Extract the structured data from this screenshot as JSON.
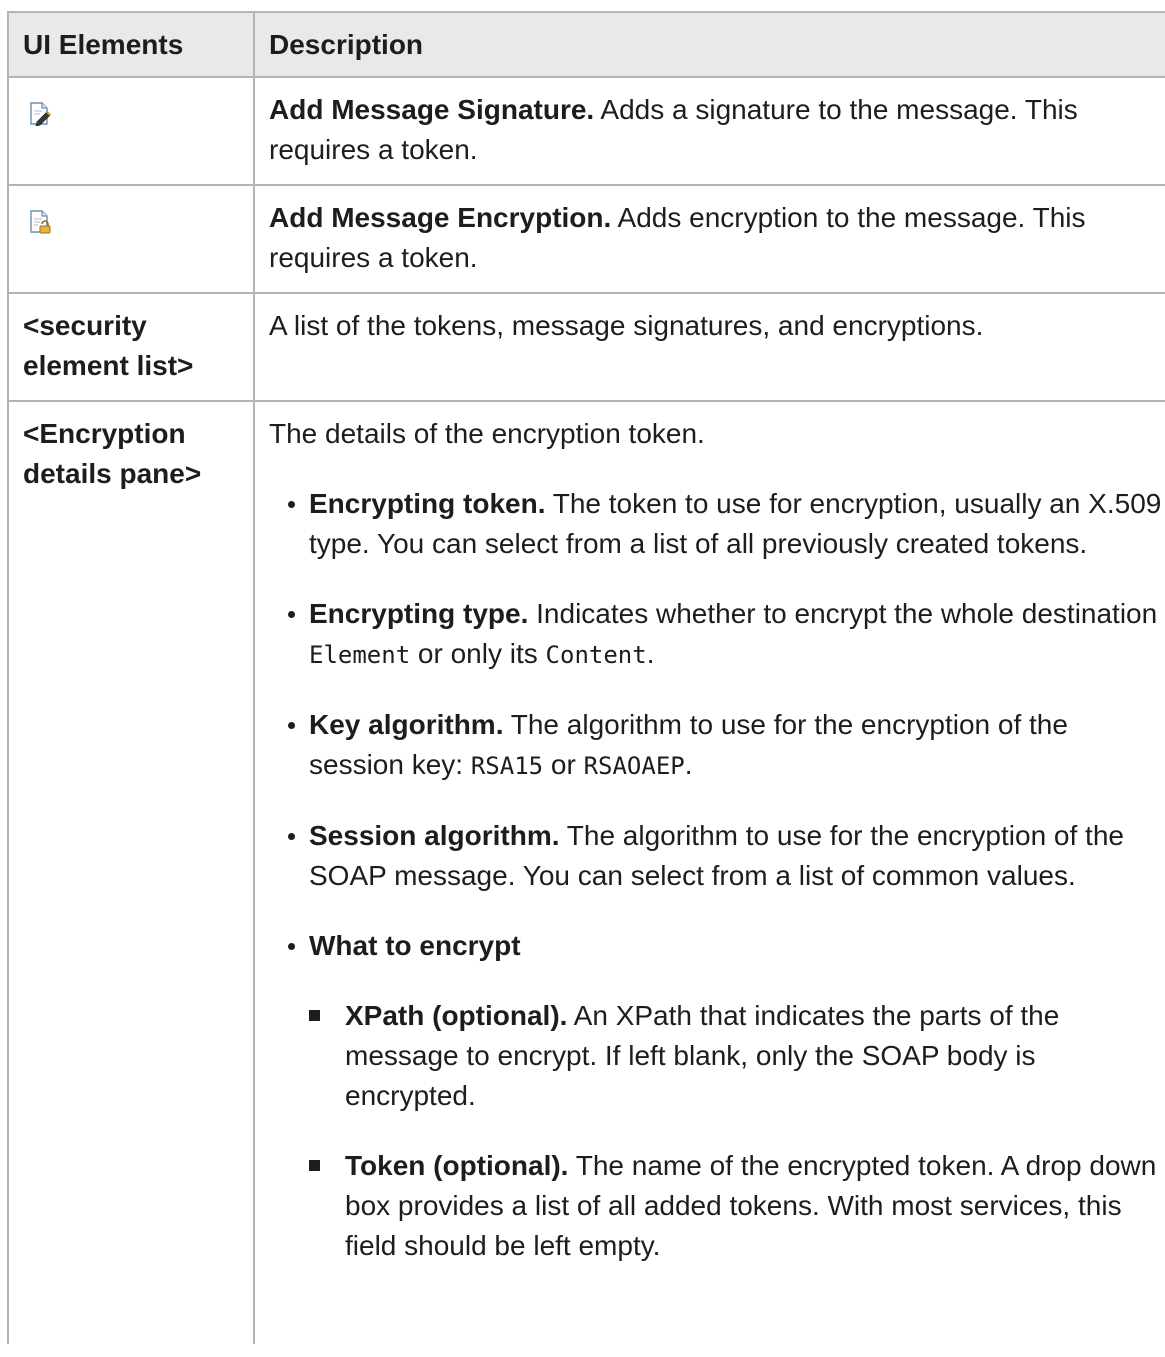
{
  "header": {
    "col1": "UI Elements",
    "col2": "Description"
  },
  "rows": {
    "signature": {
      "icon": "add-message-signature-icon",
      "title": "Add Message Signature.",
      "text": " Adds a signature to the message. This requires a token."
    },
    "encryption": {
      "icon": "add-message-encryption-icon",
      "title": "Add Message Encryption.",
      "text": " Adds encryption to the message. This requires a token."
    },
    "security_list": {
      "label": "<security element list>",
      "text": "A list of the tokens, message signatures, and encryptions."
    },
    "encryption_pane": {
      "label": "<Encryption details pane>",
      "intro": "The details of the encryption token.",
      "items": [
        {
          "title": "Encrypting token.",
          "text": " The token to use for encryption, usually an X.509 type. You can select from a list of all previously created tokens."
        },
        {
          "title": "Encrypting type.",
          "text_a": " Indicates whether to encrypt the whole destination ",
          "code_a": "Element",
          "text_b": " or only its ",
          "code_b": "Content",
          "text_c": "."
        },
        {
          "title": "Key algorithm.",
          "text_a": " The algorithm to use for the encryption of the session key: ",
          "code_a": "RSA15",
          "text_b": " or ",
          "code_b": "RSAOAEP",
          "text_c": "."
        },
        {
          "title": "Session algorithm.",
          "text": " The algorithm to use for the encryption of the SOAP message. You can select from a list of common values."
        },
        {
          "title": "What to encrypt"
        }
      ],
      "subitems": [
        {
          "title": "XPath (optional).",
          "text": " An XPath that indicates the parts of the message to encrypt. If left blank, only the SOAP body is encrypted."
        },
        {
          "title": "Token (optional).",
          "text": " The name of the encrypted token. A drop down box provides a list of all added tokens. With most services, this field should be left empty."
        }
      ]
    }
  }
}
